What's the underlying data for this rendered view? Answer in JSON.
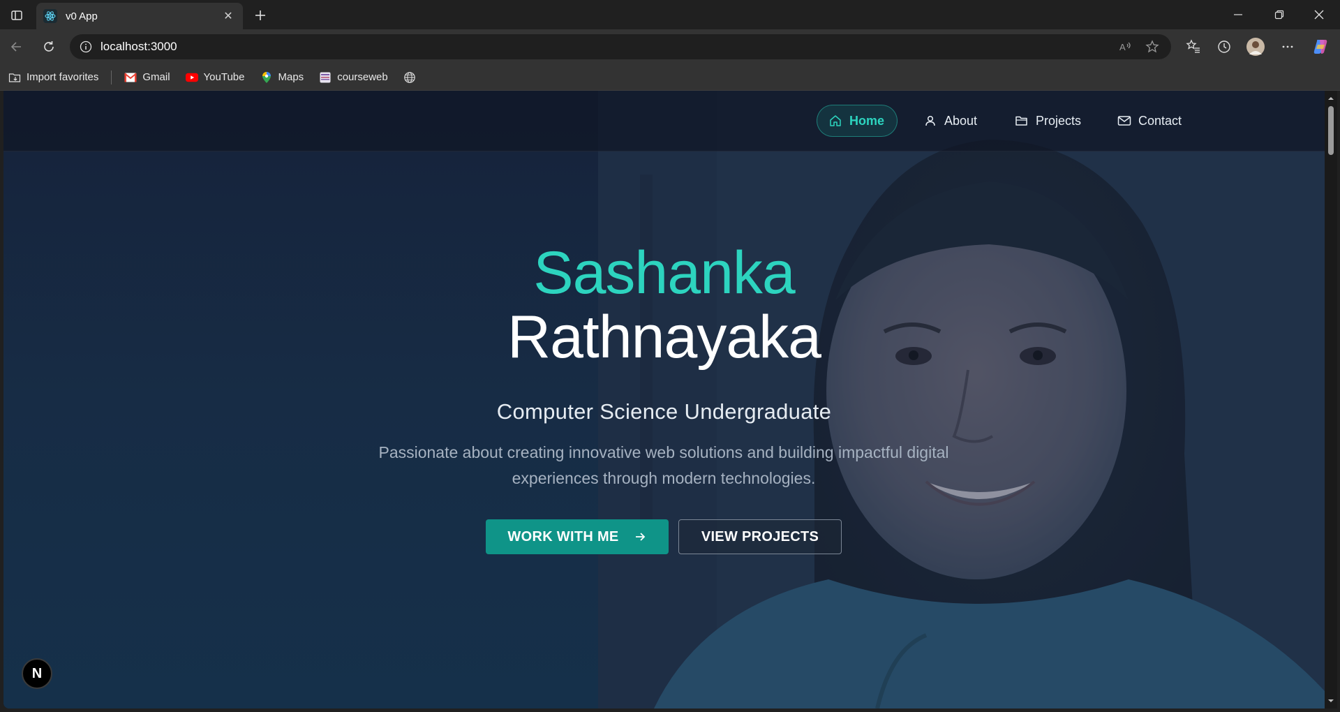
{
  "browser": {
    "tab": {
      "title": "v0 App",
      "favicon": "react-icon",
      "close_glyph": "✕"
    },
    "address": {
      "url": "localhost:3000"
    },
    "bookmarks": [
      {
        "label": "Import favorites",
        "icon": "import-folder-icon"
      },
      {
        "label": "Gmail",
        "icon": "gmail-icon"
      },
      {
        "label": "YouTube",
        "icon": "youtube-icon"
      },
      {
        "label": "Maps",
        "icon": "maps-icon"
      },
      {
        "label": "courseweb",
        "icon": "courseweb-icon"
      }
    ]
  },
  "nav": {
    "items": [
      {
        "label": "Home",
        "icon": "home-icon",
        "active": true
      },
      {
        "label": "About",
        "icon": "user-icon",
        "active": false
      },
      {
        "label": "Projects",
        "icon": "folder-icon",
        "active": false
      },
      {
        "label": "Contact",
        "icon": "mail-icon",
        "active": false
      }
    ]
  },
  "hero": {
    "first_name": "Sashanka",
    "last_name": "Rathnayaka",
    "subtitle": "Computer Science Undergraduate",
    "description": "Passionate about creating innovative web solutions and building impactful digital experiences through modern technologies.",
    "primary_button": "WORK WITH ME",
    "secondary_button": "VIEW PROJECTS"
  },
  "dev_badge": {
    "label": "N"
  },
  "colors": {
    "accent": "#2dd4bf",
    "button_primary": "#0f9488",
    "page_bg": "#172338"
  }
}
